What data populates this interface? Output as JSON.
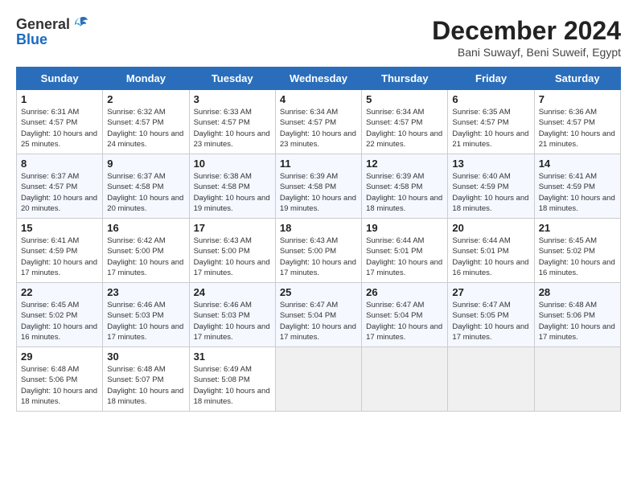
{
  "header": {
    "logo_general": "General",
    "logo_blue": "Blue",
    "month_title": "December 2024",
    "location": "Bani Suwayf, Beni Suweif, Egypt"
  },
  "days_of_week": [
    "Sunday",
    "Monday",
    "Tuesday",
    "Wednesday",
    "Thursday",
    "Friday",
    "Saturday"
  ],
  "weeks": [
    [
      {
        "day": "1",
        "sunrise": "6:31 AM",
        "sunset": "4:57 PM",
        "daylight": "10 hours and 25 minutes."
      },
      {
        "day": "2",
        "sunrise": "6:32 AM",
        "sunset": "4:57 PM",
        "daylight": "10 hours and 24 minutes."
      },
      {
        "day": "3",
        "sunrise": "6:33 AM",
        "sunset": "4:57 PM",
        "daylight": "10 hours and 23 minutes."
      },
      {
        "day": "4",
        "sunrise": "6:34 AM",
        "sunset": "4:57 PM",
        "daylight": "10 hours and 23 minutes."
      },
      {
        "day": "5",
        "sunrise": "6:34 AM",
        "sunset": "4:57 PM",
        "daylight": "10 hours and 22 minutes."
      },
      {
        "day": "6",
        "sunrise": "6:35 AM",
        "sunset": "4:57 PM",
        "daylight": "10 hours and 21 minutes."
      },
      {
        "day": "7",
        "sunrise": "6:36 AM",
        "sunset": "4:57 PM",
        "daylight": "10 hours and 21 minutes."
      }
    ],
    [
      {
        "day": "8",
        "sunrise": "6:37 AM",
        "sunset": "4:57 PM",
        "daylight": "10 hours and 20 minutes."
      },
      {
        "day": "9",
        "sunrise": "6:37 AM",
        "sunset": "4:58 PM",
        "daylight": "10 hours and 20 minutes."
      },
      {
        "day": "10",
        "sunrise": "6:38 AM",
        "sunset": "4:58 PM",
        "daylight": "10 hours and 19 minutes."
      },
      {
        "day": "11",
        "sunrise": "6:39 AM",
        "sunset": "4:58 PM",
        "daylight": "10 hours and 19 minutes."
      },
      {
        "day": "12",
        "sunrise": "6:39 AM",
        "sunset": "4:58 PM",
        "daylight": "10 hours and 18 minutes."
      },
      {
        "day": "13",
        "sunrise": "6:40 AM",
        "sunset": "4:59 PM",
        "daylight": "10 hours and 18 minutes."
      },
      {
        "day": "14",
        "sunrise": "6:41 AM",
        "sunset": "4:59 PM",
        "daylight": "10 hours and 18 minutes."
      }
    ],
    [
      {
        "day": "15",
        "sunrise": "6:41 AM",
        "sunset": "4:59 PM",
        "daylight": "10 hours and 17 minutes."
      },
      {
        "day": "16",
        "sunrise": "6:42 AM",
        "sunset": "5:00 PM",
        "daylight": "10 hours and 17 minutes."
      },
      {
        "day": "17",
        "sunrise": "6:43 AM",
        "sunset": "5:00 PM",
        "daylight": "10 hours and 17 minutes."
      },
      {
        "day": "18",
        "sunrise": "6:43 AM",
        "sunset": "5:00 PM",
        "daylight": "10 hours and 17 minutes."
      },
      {
        "day": "19",
        "sunrise": "6:44 AM",
        "sunset": "5:01 PM",
        "daylight": "10 hours and 17 minutes."
      },
      {
        "day": "20",
        "sunrise": "6:44 AM",
        "sunset": "5:01 PM",
        "daylight": "10 hours and 16 minutes."
      },
      {
        "day": "21",
        "sunrise": "6:45 AM",
        "sunset": "5:02 PM",
        "daylight": "10 hours and 16 minutes."
      }
    ],
    [
      {
        "day": "22",
        "sunrise": "6:45 AM",
        "sunset": "5:02 PM",
        "daylight": "10 hours and 16 minutes."
      },
      {
        "day": "23",
        "sunrise": "6:46 AM",
        "sunset": "5:03 PM",
        "daylight": "10 hours and 17 minutes."
      },
      {
        "day": "24",
        "sunrise": "6:46 AM",
        "sunset": "5:03 PM",
        "daylight": "10 hours and 17 minutes."
      },
      {
        "day": "25",
        "sunrise": "6:47 AM",
        "sunset": "5:04 PM",
        "daylight": "10 hours and 17 minutes."
      },
      {
        "day": "26",
        "sunrise": "6:47 AM",
        "sunset": "5:04 PM",
        "daylight": "10 hours and 17 minutes."
      },
      {
        "day": "27",
        "sunrise": "6:47 AM",
        "sunset": "5:05 PM",
        "daylight": "10 hours and 17 minutes."
      },
      {
        "day": "28",
        "sunrise": "6:48 AM",
        "sunset": "5:06 PM",
        "daylight": "10 hours and 17 minutes."
      }
    ],
    [
      {
        "day": "29",
        "sunrise": "6:48 AM",
        "sunset": "5:06 PM",
        "daylight": "10 hours and 18 minutes."
      },
      {
        "day": "30",
        "sunrise": "6:48 AM",
        "sunset": "5:07 PM",
        "daylight": "10 hours and 18 minutes."
      },
      {
        "day": "31",
        "sunrise": "6:49 AM",
        "sunset": "5:08 PM",
        "daylight": "10 hours and 18 minutes."
      },
      null,
      null,
      null,
      null
    ]
  ]
}
